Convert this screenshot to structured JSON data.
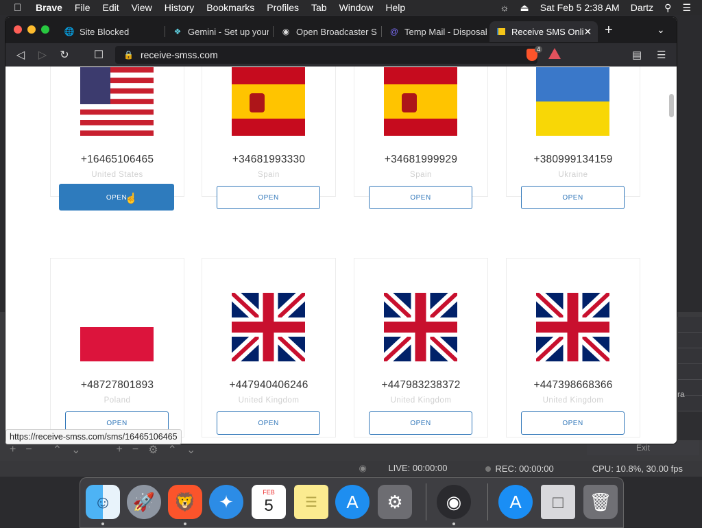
{
  "menubar": {
    "app_name": "Brave",
    "menus": [
      "File",
      "Edit",
      "View",
      "History",
      "Bookmarks",
      "Profiles",
      "Tab",
      "Window",
      "Help"
    ],
    "datetime": "Sat Feb 5  2:38 AM",
    "user": "Dartz"
  },
  "browser": {
    "tabs": [
      {
        "title": "Site Blocked",
        "icon": "globe-icon"
      },
      {
        "title": "Gemini - Set up your",
        "icon": "gemini-icon"
      },
      {
        "title": "Open Broadcaster So",
        "icon": "obs-icon"
      },
      {
        "title": "Temp Mail - Disposab",
        "icon": "tempmail-icon"
      },
      {
        "title": "Receive SMS Onli",
        "icon": "sms-icon",
        "active": true
      }
    ],
    "url": "receive-smss.com",
    "shield_count": "4",
    "status_url": "https://receive-smss.com/sms/16465106465"
  },
  "cards": [
    {
      "number": "+16465106465",
      "country": "United States",
      "flag": "us-flag-icon",
      "button": "OPEN"
    },
    {
      "number": "+34681993330",
      "country": "Spain",
      "flag": "spain-flag-icon",
      "button": "OPEN"
    },
    {
      "number": "+34681999929",
      "country": "Spain",
      "flag": "spain-flag-icon",
      "button": "OPEN"
    },
    {
      "number": "+380999134159",
      "country": "Ukraine",
      "flag": "ukraine-flag-icon",
      "button": "OPEN"
    },
    {
      "number": "+48727801893",
      "country": "Poland",
      "flag": "poland-flag-icon",
      "button": "OPEN"
    },
    {
      "number": "+447940406246",
      "country": "United Kingdom",
      "flag": "uk-flag-icon",
      "button": "OPEN"
    },
    {
      "number": "+447983238372",
      "country": "United Kingdom",
      "flag": "uk-flag-icon",
      "button": "OPEN"
    },
    {
      "number": "+447398668366",
      "country": "United Kingdom",
      "flag": "uk-flag-icon",
      "button": "OPEN"
    }
  ],
  "obs": {
    "live": "LIVE: 00:00:00",
    "rec": "REC: 00:00:00",
    "cpu": "CPU: 10.8%, 30.00 fps",
    "exit": "Exit",
    "side_label": "ra"
  },
  "dock": {
    "items": [
      "finder-icon",
      "launchpad-icon",
      "brave-icon",
      "safari-icon",
      "calendar-icon",
      "notes-icon",
      "app-store-icon",
      "system-preferences-icon",
      "obs-icon",
      "downloads-icon",
      "installer-icon",
      "trash-icon"
    ],
    "calendar_month": "FEB",
    "calendar_day": "5"
  },
  "colors": {
    "accent": "#2e75b8",
    "tab_active": "#2d2d31",
    "brave_orange": "#fb542b"
  }
}
